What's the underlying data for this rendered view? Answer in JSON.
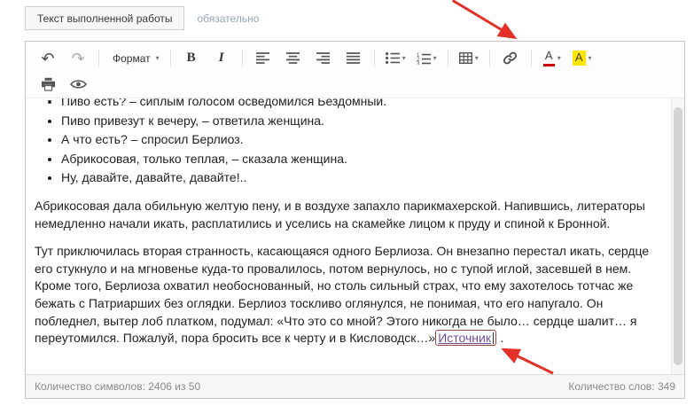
{
  "tabs": {
    "active_label": "Текст выполненной работы",
    "required_label": "обязательно"
  },
  "toolbar": {
    "format_label": "Формат",
    "bold_label": "B",
    "italic_label": "I",
    "text_color_letter": "A",
    "bg_color_letter": "A"
  },
  "icons": {
    "undo": "↶",
    "redo": "↷",
    "caret": "▾",
    "ol_digits": [
      "1",
      "2",
      "3"
    ]
  },
  "editor": {
    "list_items": [
      "Пиво есть? – сиплым голосом осведомился Бездомный.",
      "Пиво привезут к вечеру, – ответила женщина.",
      "А что есть? – спросил Берлиоз.",
      "Абрикосовая, только теплая, – сказала женщина.",
      "Ну, давайте, давайте, давайте!.."
    ],
    "paragraph1": "Абрикосовая дала обильную желтую пену, и в воздухе запахло парикмахерской. Напившись, литераторы немедленно начали икать, расплатились и уселись на скамейке лицом к пруду и спиной к Бронной.",
    "paragraph2": "Тут приключилась вторая странность, касающаяся одного Берлиоза. Он внезапно перестал икать, сердце его стукнуло и на мгновенье куда-то провалилось, потом вернулось, но с тупой иглой, засевшей в нем. Кроме того, Берлиоза охватил необоснованный, но столь сильный страх, что ему захотелось тотчас же бежать с Патриарших без оглядки. Берлиоз тоскливо оглянулся, не понимая, что его напугало. Он побледнел, вытер лоб платком, подумал: «Что это со мной? Этого никогда не было… сердце шалит… я переутомился. Пожалуй, пора бросить все к черту и в Кисловодск…»",
    "link_text": "Источник",
    "after_link": " ."
  },
  "footer": {
    "char_count": "Количество символов: 2406 из 50",
    "word_count": "Количество слов: 349"
  },
  "colors": {
    "arrow": "#e43127",
    "link": "#6b4fa1",
    "text-color-bar": "#cc0000",
    "bg-color-swatch": "#ffe500",
    "link-box": "#9b4340"
  }
}
